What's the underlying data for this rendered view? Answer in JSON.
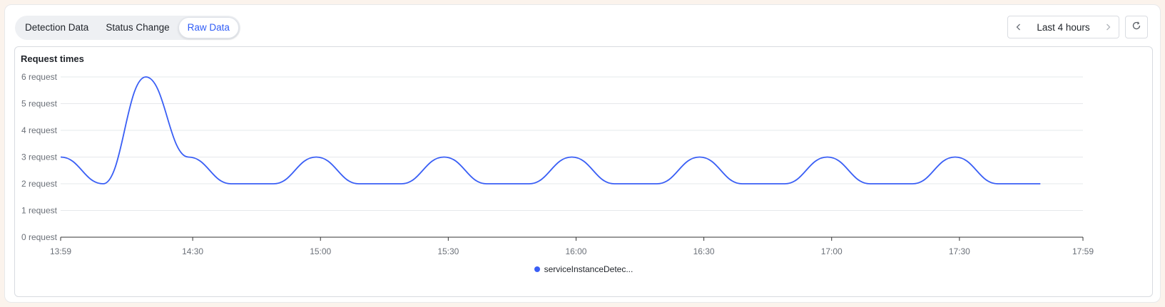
{
  "tabs": [
    {
      "label": "Detection Data",
      "active": false
    },
    {
      "label": "Status Change",
      "active": false
    },
    {
      "label": "Raw Data",
      "active": true
    }
  ],
  "time_range": {
    "label": "Last 4 hours",
    "prev_icon": "chevron-left-icon",
    "next_icon": "chevron-right-icon"
  },
  "refresh_icon": "refresh-icon",
  "colors": {
    "accent": "#2f5cf6",
    "series": "#3a5ff5",
    "grid": "#e6e8eb"
  },
  "chart_data": {
    "type": "line",
    "title": "Request times",
    "y_ticks": [
      "0 request",
      "1 request",
      "2 request",
      "3 request",
      "4 request",
      "5 request",
      "6 request"
    ],
    "x_ticks": [
      "13:59",
      "14:30",
      "15:00",
      "15:30",
      "16:00",
      "16:30",
      "17:00",
      "17:30",
      "17:59"
    ],
    "ylim": [
      0,
      6
    ],
    "xlim": [
      "13:59",
      "17:59"
    ],
    "grid": true,
    "legend_position": "bottom",
    "series": [
      {
        "name": "serviceInstanceDetec...",
        "points": [
          [
            "13:59",
            3
          ],
          [
            "14:09",
            2
          ],
          [
            "14:19",
            6
          ],
          [
            "14:29",
            3
          ],
          [
            "14:39",
            2
          ],
          [
            "14:49",
            2
          ],
          [
            "14:59",
            3
          ],
          [
            "15:09",
            2
          ],
          [
            "15:19",
            2
          ],
          [
            "15:29",
            3
          ],
          [
            "15:39",
            2
          ],
          [
            "15:49",
            2
          ],
          [
            "15:59",
            3
          ],
          [
            "16:09",
            2
          ],
          [
            "16:19",
            2
          ],
          [
            "16:29",
            3
          ],
          [
            "16:39",
            2
          ],
          [
            "16:49",
            2
          ],
          [
            "16:59",
            3
          ],
          [
            "17:09",
            2
          ],
          [
            "17:19",
            2
          ],
          [
            "17:29",
            3
          ],
          [
            "17:39",
            2
          ],
          [
            "17:49",
            2
          ]
        ]
      }
    ]
  }
}
